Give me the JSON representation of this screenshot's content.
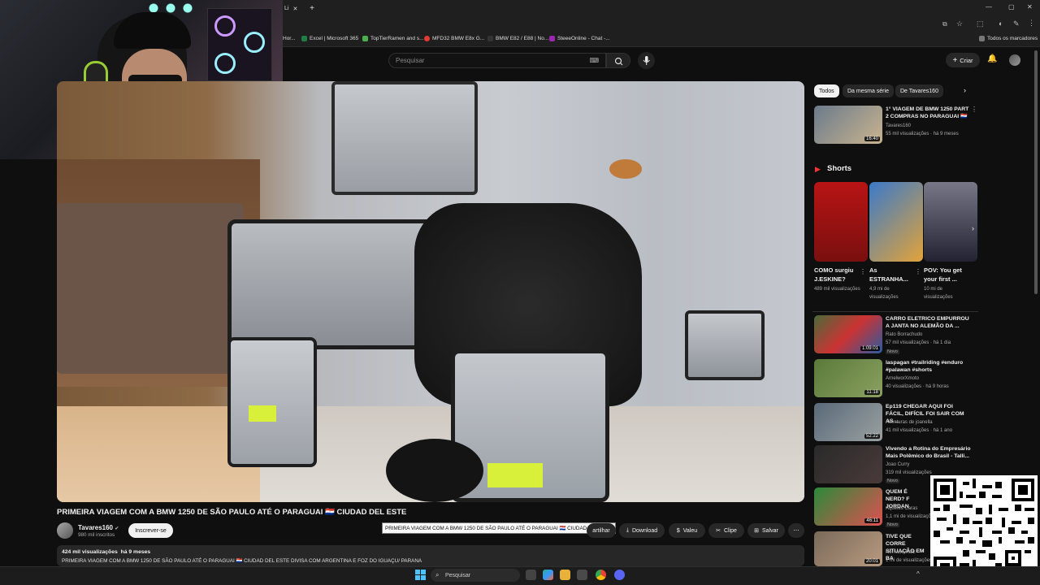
{
  "browser": {
    "tabs": [
      {
        "label": "Li"
      }
    ],
    "new_tab_label": "+",
    "bookmarks": [
      {
        "label": "Hor...",
        "color": "#4caf50"
      },
      {
        "label": "Excel | Microsoft 365",
        "color": "#1e7e45"
      },
      {
        "label": "TopTierRamen and s...",
        "color": "#4caf50"
      },
      {
        "label": "MFD32 BMW E8x G...",
        "color": "#e53935"
      },
      {
        "label": "BMW E82 / E88 | No...",
        "color": "#333333"
      },
      {
        "label": "SteeeOnline - Chat -...",
        "color": "#9c27b0"
      }
    ],
    "all_bookmarks": "Todos os marcadores"
  },
  "youtube": {
    "search_placeholder": "Pesquisar",
    "create_label": "Criar",
    "video": {
      "title": "PRIMEIRA VIAGEM COM A BMW 1250 DE SÃO PAULO ATÉ O PARAGUAI 🇵🇾 CIUDAD DEL ESTE",
      "tooltip": "PRIMEIRA VIAGEM COM A BMW 1250 DE SÃO PAULO ATÉ O PARAGUAI 🇵🇾 CIUDAD DEL ESTE",
      "channel": "Tavares160",
      "subscribers": "980 mil inscritos",
      "subscribe_label": "Inscrever-se",
      "actions": {
        "share": "artilhar",
        "download": "Download",
        "thanks": "Valeu",
        "clip": "Clipe",
        "save": "Salvar"
      },
      "views": "424 mil visualizações",
      "age": "há 9 meses",
      "description": "PRIMEIRA VIAGEM COM A BMW 1250 DE SÃO PAULO ATÉ O PARAGUAI 🇵🇾 CIUDAD DEL ESTE DIVISA COM ARGENTINA E FOZ DO IGUAÇU/ PARANA"
    },
    "chips": [
      {
        "label": "Todos",
        "active": true
      },
      {
        "label": "Da mesma série",
        "active": false
      },
      {
        "label": "De Tavares160",
        "active": false
      }
    ],
    "shorts_heading": "Shorts",
    "shorts": [
      {
        "title": "COMO surgiu J.ESKINE?",
        "views": "489 mil visualizações"
      },
      {
        "title": "As ESTRANHA...",
        "views": "4,9 mi de visualizações"
      },
      {
        "title": "POV: You get your first ...",
        "views": "10 mi de visualizações"
      }
    ],
    "recommendations": [
      {
        "title": "1° VIAGEM DE BMW 1250 PART 2 COMPRAS NO PARAGUAI 🇵🇾",
        "channel": "Tavares160",
        "meta": "55 mil visualizações · há 9 meses",
        "duration": "16:40",
        "new": false
      },
      {
        "title": "CARRO ELETRICO EMPURROU A JANTA NO ALEMÃO DA ...",
        "channel": "Rato Borrachudo",
        "meta": "57 mil visualizações · há 1 dia",
        "duration": "1:09:01",
        "new": true
      },
      {
        "title": "laspagan #trailriding #enduro #palawan #shorts",
        "channel": "ArnelworXmoto",
        "meta": "40 visualizações · há 9 horas",
        "duration": "11:18",
        "new": false
      },
      {
        "title": "Ep119 CHEGAR AQUI FOI FÁCIL, DIFÍCIL FOI SAIR COM AS ...",
        "channel": "Aventuras de joanella",
        "meta": "41 mil visualizações · há 1 ano",
        "duration": "52:22",
        "new": false
      },
      {
        "title": "Vivendo a Rotina do Empresário Mais Polêmico do Brasil - Talli...",
        "channel": "Joao Curry",
        "meta": "319 mil visualizações",
        "duration": "",
        "new": true
      },
      {
        "title": "QUEM É NERD? F JORDAN",
        "channel": "Aqueles Caras",
        "meta": "1,1 mi de visualizações",
        "duration": "46:11",
        "new": true
      },
      {
        "title": "TIVE QUE CORRE SITUAÇÃO EM BA",
        "channel": "Nômade Ratz",
        "meta": "1 mi de visualizações",
        "duration": "20:01",
        "new": false
      }
    ]
  },
  "taskbar": {
    "search_label": "Pesquisar"
  }
}
